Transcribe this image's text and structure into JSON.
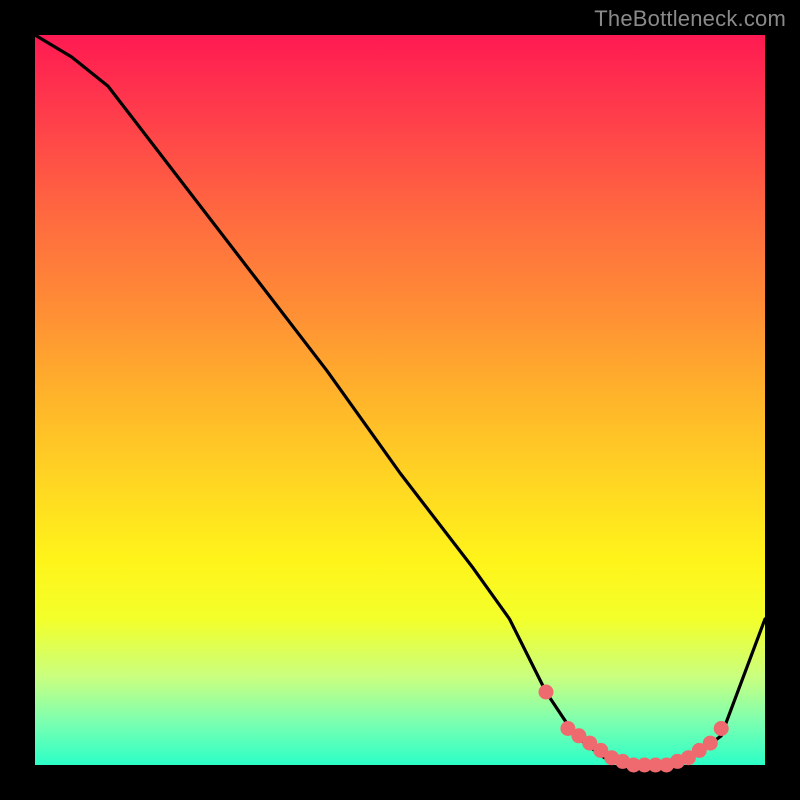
{
  "watermark": "TheBottleneck.com",
  "colors": {
    "background": "#000000",
    "gradient_top": "#ff1a52",
    "gradient_mid": "#ffd822",
    "gradient_bottom": "#2bffc7",
    "curve": "#000000",
    "markers": "#ef6a6e"
  },
  "chart_data": {
    "type": "line",
    "title": "",
    "xlabel": "",
    "ylabel": "",
    "xlim": [
      0,
      100
    ],
    "ylim": [
      0,
      100
    ],
    "series": [
      {
        "name": "bottleneck-curve",
        "x": [
          0,
          5,
          10,
          20,
          30,
          40,
          50,
          60,
          65,
          70,
          74,
          78,
          82,
          86,
          90,
          94,
          100
        ],
        "y": [
          100,
          97,
          93,
          80,
          67,
          54,
          40,
          27,
          20,
          10,
          4,
          1,
          0,
          0,
          1,
          4,
          20
        ]
      }
    ],
    "markers": {
      "name": "highlight-points",
      "x": [
        70,
        73,
        74.5,
        76,
        77.5,
        79,
        80.5,
        82,
        83.5,
        85,
        86.5,
        88,
        89.5,
        91,
        92.5,
        94
      ],
      "y": [
        10,
        5,
        4,
        3,
        2,
        1,
        0.5,
        0,
        0,
        0,
        0,
        0.5,
        1,
        2,
        3,
        5
      ]
    }
  }
}
